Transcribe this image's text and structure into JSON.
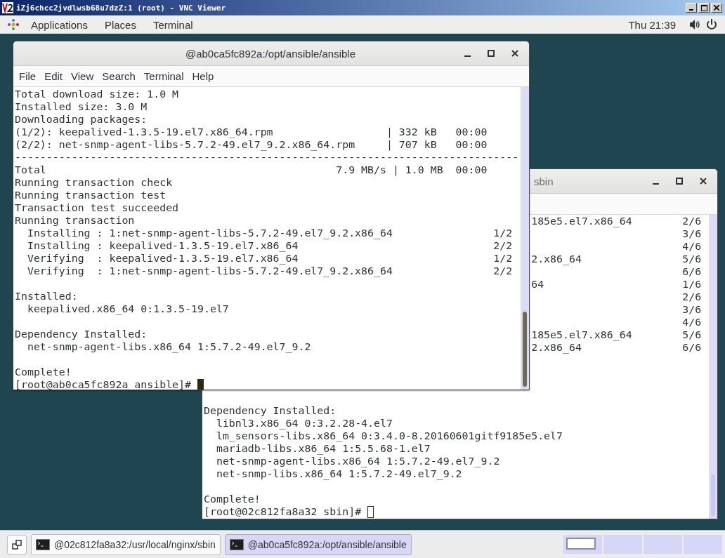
{
  "vnc_window": {
    "title": "iZj6chcc2jvdlwsb68u7dzZ:1 (root) - VNC Viewer"
  },
  "top_panel": {
    "menus": [
      "Applications",
      "Places",
      "Terminal"
    ],
    "clock": "Thu 21:39"
  },
  "back_terminal": {
    "title": "sbin",
    "focused": false,
    "lines": [
      {
        "kind": "partial",
        "text": "185e5.el7.x86_64",
        "count": "2/6"
      },
      {
        "kind": "partial",
        "count": "3/6"
      },
      {
        "kind": "partial",
        "count": "4/6"
      },
      {
        "kind": "partial",
        "text": "2.x86_64",
        "count": "5/6"
      },
      {
        "kind": "partial",
        "count": "6/6"
      },
      {
        "kind": "partial",
        "text": "64",
        "count": "1/6"
      },
      {
        "kind": "partial",
        "count": "2/6"
      },
      {
        "kind": "partial",
        "count": "3/6"
      },
      {
        "kind": "partial",
        "count": "4/6"
      },
      {
        "kind": "partial",
        "text": "185e5.el7.x86_64",
        "count": "5/6"
      },
      {
        "kind": "partial",
        "text": "2.x86_64",
        "count": "6/6"
      },
      {
        "kind": "blank"
      },
      {
        "kind": "blank"
      },
      {
        "kind": "blank"
      },
      {
        "kind": "blank"
      },
      {
        "kind": "text",
        "text": "Dependency Installed:"
      },
      {
        "kind": "text",
        "text": "  libnl3.x86_64 0:3.2.28-4.el7"
      },
      {
        "kind": "text",
        "text": "  lm_sensors-libs.x86_64 0:3.4.0-8.20160601gitf9185e5.el7"
      },
      {
        "kind": "text",
        "text": "  mariadb-libs.x86_64 1:5.5.68-1.el7"
      },
      {
        "kind": "text",
        "text": "  net-snmp-agent-libs.x86_64 1:5.7.2-49.el7_9.2"
      },
      {
        "kind": "text",
        "text": "  net-snmp-libs.x86_64 1:5.7.2-49.el7_9.2"
      },
      {
        "kind": "blank"
      },
      {
        "kind": "text",
        "text": "Complete!"
      },
      {
        "kind": "prompt",
        "text": "[root@02c812fa8a32 sbin]#"
      }
    ]
  },
  "front_terminal": {
    "title": "@ab0ca5fc892a:/opt/ansible/ansible",
    "focused": true,
    "menu": [
      "File",
      "Edit",
      "View",
      "Search",
      "Terminal",
      "Help"
    ],
    "lines": [
      {
        "kind": "text",
        "text": "Total download size: 1.0 M"
      },
      {
        "kind": "text",
        "text": "Installed size: 3.0 M"
      },
      {
        "kind": "text",
        "text": "Downloading packages:"
      },
      {
        "kind": "text",
        "text": "(1/2): keepalived-1.3.5-19.el7.x86_64.rpm                  | 332 kB   00:00"
      },
      {
        "kind": "text",
        "text": "(2/2): net-snmp-agent-libs-5.7.2-49.el7_9.2.x86_64.rpm     | 707 kB   00:00"
      },
      {
        "kind": "text",
        "text": "--------------------------------------------------------------------------------"
      },
      {
        "kind": "text",
        "text": "Total                                              7.9 MB/s | 1.0 MB  00:00"
      },
      {
        "kind": "text",
        "text": "Running transaction check"
      },
      {
        "kind": "text",
        "text": "Running transaction test"
      },
      {
        "kind": "text",
        "text": "Transaction test succeeded"
      },
      {
        "kind": "text",
        "text": "Running transaction"
      },
      {
        "kind": "text",
        "text": "  Installing : 1:net-snmp-agent-libs-5.7.2-49.el7_9.2.x86_64                1/2"
      },
      {
        "kind": "text",
        "text": "  Installing : keepalived-1.3.5-19.el7.x86_64                               2/2"
      },
      {
        "kind": "text",
        "text": "  Verifying  : keepalived-1.3.5-19.el7.x86_64                               1/2"
      },
      {
        "kind": "text",
        "text": "  Verifying  : 1:net-snmp-agent-libs-5.7.2-49.el7_9.2.x86_64                2/2"
      },
      {
        "kind": "blank"
      },
      {
        "kind": "text",
        "text": "Installed:"
      },
      {
        "kind": "text",
        "text": "  keepalived.x86_64 0:1.3.5-19.el7"
      },
      {
        "kind": "blank"
      },
      {
        "kind": "text",
        "text": "Dependency Installed:"
      },
      {
        "kind": "text",
        "text": "  net-snmp-agent-libs.x86_64 1:5.7.2-49.el7_9.2"
      },
      {
        "kind": "blank"
      },
      {
        "kind": "text",
        "text": "Complete!"
      },
      {
        "kind": "prompt",
        "text": "[root@ab0ca5fc892a ansible]#"
      }
    ]
  },
  "taskbar": {
    "tasks": [
      {
        "label": "@02c812fa8a32:/usr/local/nginx/sbin",
        "selected": false
      },
      {
        "label": "@ab0ca5fc892a:/opt/ansible/ansible",
        "selected": true
      }
    ]
  }
}
